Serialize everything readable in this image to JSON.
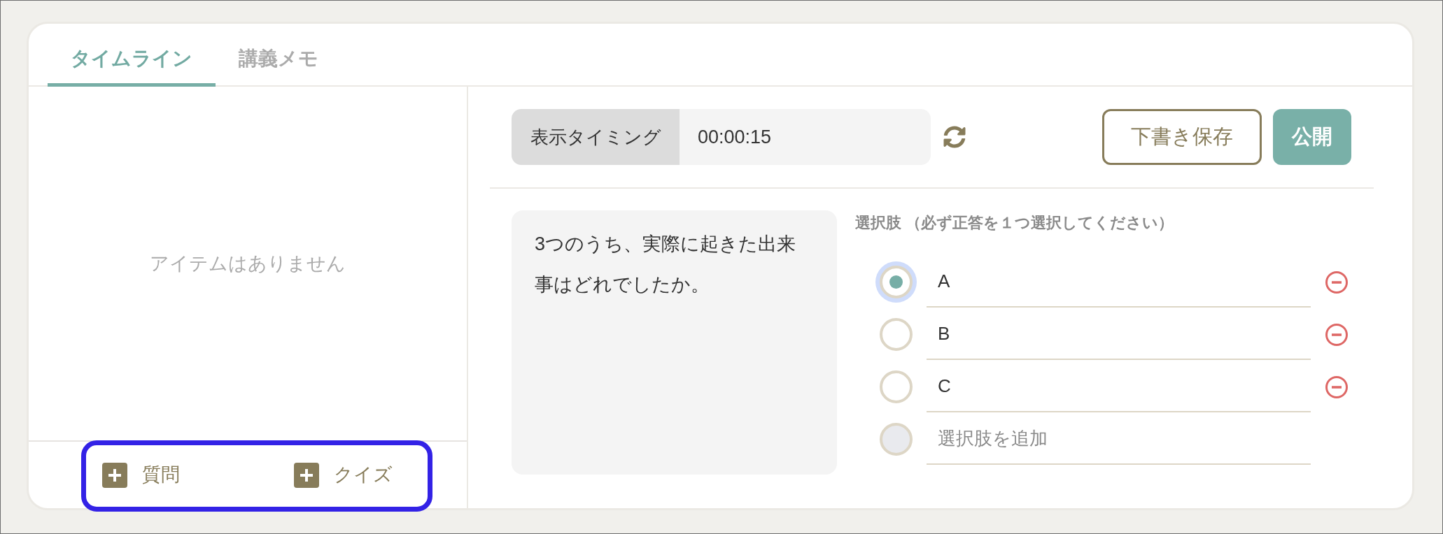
{
  "tabs": [
    {
      "label": "タイムライン",
      "selected": true
    },
    {
      "label": "講義メモ",
      "selected": false
    }
  ],
  "timeline": {
    "empty_message": "アイテムはありません",
    "add_bar": {
      "highlighted": true,
      "buttons": [
        {
          "label": "質問"
        },
        {
          "label": "クイズ"
        }
      ]
    }
  },
  "toolbar": {
    "timing_label": "表示タイミング",
    "timing_value": "00:00:15",
    "buttons": [
      {
        "label": "下書き保存",
        "kind": "outline"
      },
      {
        "label": "公開",
        "kind": "primary"
      }
    ]
  },
  "question": {
    "text": "3つのうち、実際に起きた出来事はどれでしたか。"
  },
  "choices": {
    "heading": "選択肢 （必ず正答を１つ選択してください）",
    "items": [
      {
        "value": "A",
        "selected": true
      },
      {
        "value": "B",
        "selected": false
      },
      {
        "value": "C",
        "selected": false
      }
    ],
    "add_choice": {
      "placeholder": "選択肢を追加",
      "disabled": true
    }
  }
}
